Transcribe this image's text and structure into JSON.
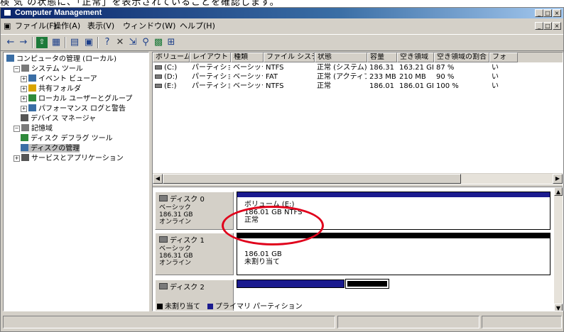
{
  "caption": "検 気 の状態に、「正常」を表示されていることを確認します。",
  "window": {
    "title": "Computer Management",
    "caption_buttons": [
      "_",
      "□",
      "×"
    ]
  },
  "menubar": {
    "items": [
      "ファイル(F)",
      "操作(A)",
      "表示(V)",
      "ウィンドウ(W)",
      "ヘルプ(H)"
    ],
    "mdi_buttons": [
      "_",
      "□",
      "×"
    ]
  },
  "toolbar": {
    "icons": [
      "back-icon",
      "forward-icon",
      "up-folder-icon",
      "show-hide-tree-icon",
      "properties-icon",
      "refresh-icon",
      "help-icon",
      "delete-icon",
      "export-icon",
      "search-icon",
      "map-icon",
      "view-icon"
    ]
  },
  "tree": {
    "nodes": [
      {
        "label": "コンピュータの管理 (ローカル)",
        "icon": "computer-icon",
        "indent": 0,
        "expander": ""
      },
      {
        "label": "システム ツール",
        "icon": "tools-icon",
        "indent": 1,
        "expander": "−"
      },
      {
        "label": "イベント ビューア",
        "icon": "event-viewer-icon",
        "indent": 2,
        "expander": "+"
      },
      {
        "label": "共有フォルダ",
        "icon": "shared-folder-icon",
        "indent": 2,
        "expander": "+"
      },
      {
        "label": "ローカル ユーザーとグループ",
        "icon": "users-icon",
        "indent": 2,
        "expander": "+"
      },
      {
        "label": "パフォーマンス ログと警告",
        "icon": "performance-icon",
        "indent": 2,
        "expander": "+"
      },
      {
        "label": "デバイス マネージャ",
        "icon": "device-manager-icon",
        "indent": 2,
        "expander": ""
      },
      {
        "label": "記憶域",
        "icon": "storage-icon",
        "indent": 1,
        "expander": "−"
      },
      {
        "label": "ディスク デフラグ ツール",
        "icon": "defrag-icon",
        "indent": 2,
        "expander": ""
      },
      {
        "label": "ディスクの管理",
        "icon": "disk-management-icon",
        "indent": 2,
        "expander": "",
        "selected": true
      },
      {
        "label": "サービスとアプリケーション",
        "icon": "services-icon",
        "indent": 1,
        "expander": "+"
      }
    ]
  },
  "volume_list": {
    "columns": [
      "ボリューム",
      "レイアウト",
      "種類",
      "ファイル システム",
      "状態",
      "容量",
      "空き領域",
      "空き領域の割合",
      "フォ"
    ],
    "rows": [
      {
        "icon": "volume-icon",
        "cells": [
          "(C:)",
          "パーティション",
          "ベーシック",
          "NTFS",
          "正常 (システム)",
          "186.31 GB",
          "163.21 GB",
          "87 %",
          "い"
        ]
      },
      {
        "icon": "volume-icon",
        "cells": [
          "(D:)",
          "パーティション",
          "ベーシック",
          "FAT",
          "正常 (アクティブ)",
          "233 MB",
          "210 MB",
          "90 %",
          "い"
        ]
      },
      {
        "icon": "volume-icon",
        "cells": [
          "(E:)",
          "パーティション",
          "ベーシック",
          "NTFS",
          "正常",
          "186.01 GB",
          "186.01 GB",
          "100 %",
          "い"
        ]
      }
    ]
  },
  "disks": [
    {
      "name": "ディスク 0",
      "lines": [
        "ベーシック",
        "186.31 GB",
        "オンライン"
      ],
      "icon": "disk-icon",
      "volume_lines": [
        "ボリューム (E:)",
        "186.01 GB NTFS",
        "正常"
      ],
      "bar_color": "#1b1b8f"
    },
    {
      "name": "ディスク 1",
      "lines": [
        "ベーシック",
        "186.31 GB",
        "オンライン"
      ],
      "icon": "disk-icon",
      "volume_lines": [
        "186.01 GB",
        "未割り当て"
      ],
      "bar_color": "#000000"
    },
    {
      "name": "ディスク 2",
      "lines": [],
      "icon": "disk-icon"
    }
  ],
  "legend": [
    {
      "label": "未割り当て",
      "color": "#000000"
    },
    {
      "label": "プライマリ パーティション",
      "color": "#1b1b8f"
    }
  ],
  "colors": {
    "primary_partition": "#1b1b8f",
    "unallocated": "#000000",
    "highlight": "#e0001b",
    "title_bar": "#0a246a"
  }
}
